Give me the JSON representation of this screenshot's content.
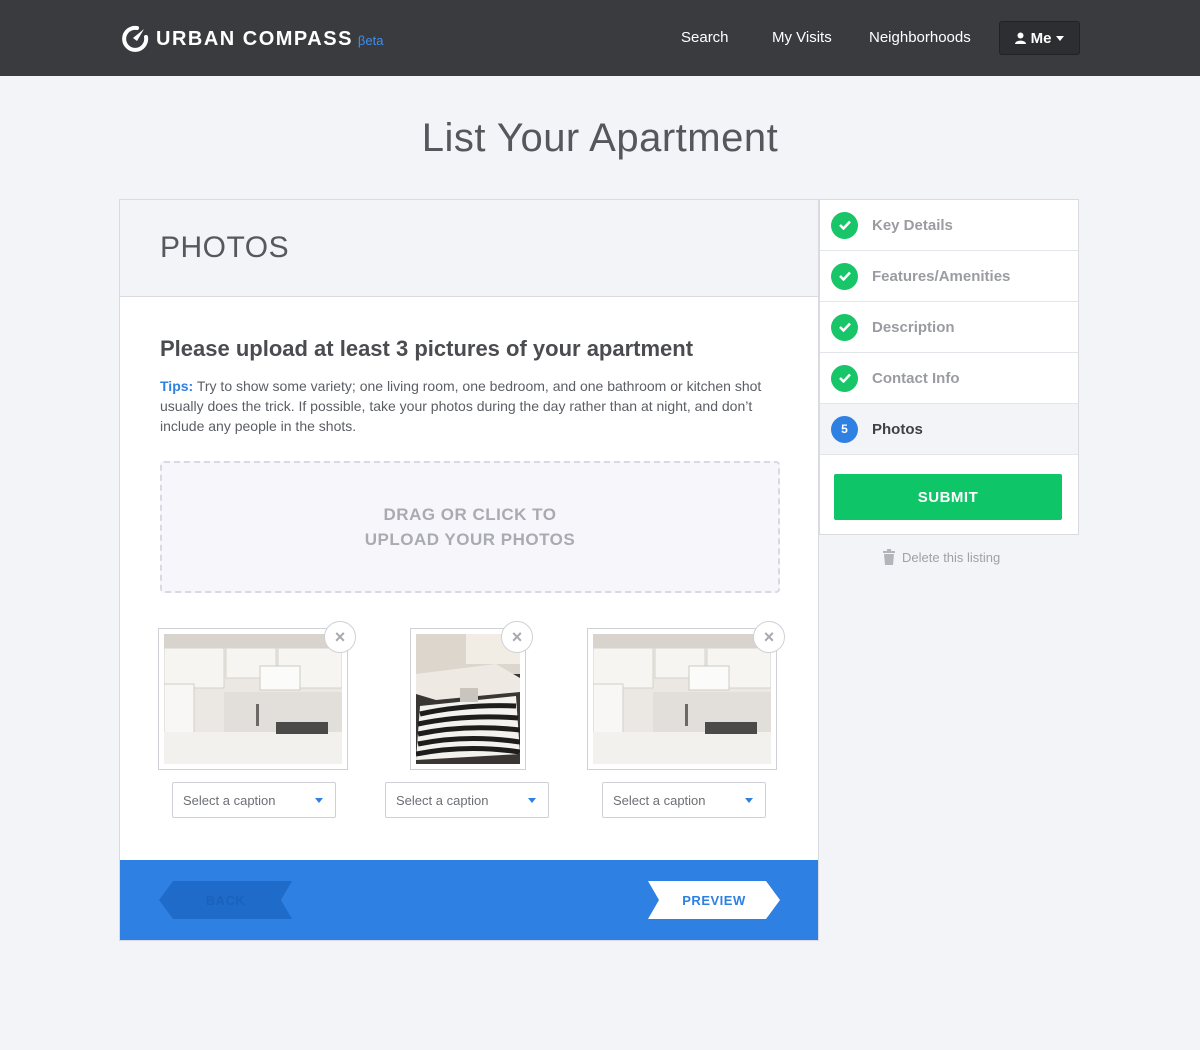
{
  "header": {
    "brand": "URBAN COMPASS",
    "beta": "βeta",
    "nav": [
      "Search",
      "My Visits",
      "Neighborhoods"
    ],
    "user_menu": "Me"
  },
  "page_title": "List Your Apartment",
  "section": {
    "title": "PHOTOS",
    "heading": "Please upload at least 3 pictures of your apartment",
    "tips_label": "Tips:",
    "tips_text": " Try to show some variety; one living room,  one bedroom, and one bathroom or kitchen shot usually does the trick. If possible, take your photos during the day rather than at night, and don’t include any people in the shots."
  },
  "dropzone": {
    "line1": "DRAG OR CLICK TO",
    "line2": "UPLOAD YOUR PHOTOS"
  },
  "photos": [
    {
      "image": "kitchen-photo",
      "caption_placeholder": "Select a caption"
    },
    {
      "image": "living-room-photo",
      "caption_placeholder": "Select a caption"
    },
    {
      "image": "kitchen-photo",
      "caption_placeholder": "Select a caption"
    }
  ],
  "footer": {
    "back": "BACK",
    "preview": "PREVIEW"
  },
  "steps": [
    {
      "label": "Key Details",
      "status": "complete"
    },
    {
      "label": "Features/Amenities",
      "status": "complete"
    },
    {
      "label": "Description",
      "status": "complete"
    },
    {
      "label": "Contact Info",
      "status": "complete"
    },
    {
      "label": "Photos",
      "status": "active",
      "number": "5"
    }
  ],
  "submit": "SUBMIT",
  "delete_listing": "Delete this listing",
  "colors": {
    "header_bg": "#393b3f",
    "accent_blue": "#2f80e3",
    "success_green": "#0ec567",
    "page_bg": "#f3f4f8"
  }
}
